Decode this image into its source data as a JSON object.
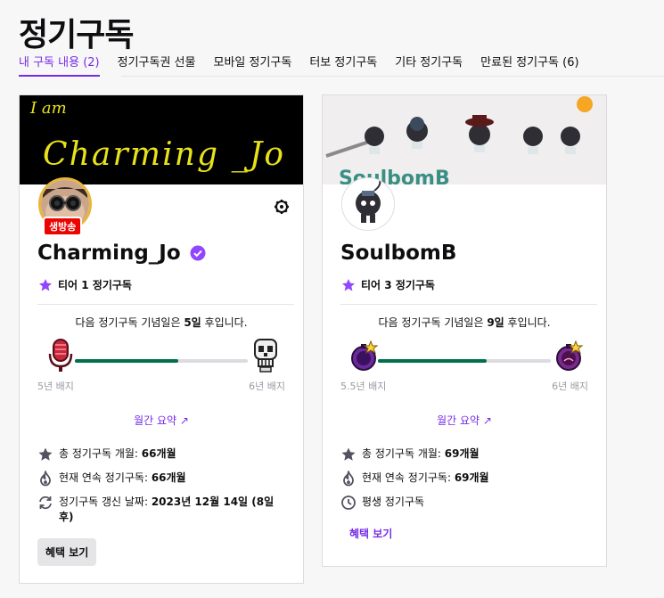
{
  "page": {
    "title": "정기구독"
  },
  "tabs": [
    {
      "label": "내 구독 내용 (2)",
      "active": true
    },
    {
      "label": "정기구독권 선물",
      "active": false
    },
    {
      "label": "모바일 정기구독",
      "active": false
    },
    {
      "label": "터보 정기구독",
      "active": false
    },
    {
      "label": "기타 정기구독",
      "active": false
    },
    {
      "label": "만료된 정기구독 (6)",
      "active": false
    }
  ],
  "subscriptions": [
    {
      "banner_text": [
        "I am",
        "Charming _Jo"
      ],
      "live_label": "생방송",
      "name": "Charming_Jo",
      "verified": true,
      "tier": "티어 1 정기구독",
      "anniversary": {
        "prefix": "다음 정기구독 기념일은 ",
        "days": "5일",
        "suffix": " 후입니다."
      },
      "progress": 0.6,
      "badge_current": "5년 배지",
      "badge_next": "6년 배지",
      "monthly_recap": "월간 요약 ↗",
      "stats": [
        {
          "icon": "star-icon",
          "label": "총 정기구독 개월: ",
          "value": "66개월"
        },
        {
          "icon": "flame-icon",
          "label": "현재 연속 정기구독: ",
          "value": "66개월"
        },
        {
          "icon": "renew-icon",
          "label": "정기구독 갱신 날짜: ",
          "value": "2023년 12월 14일 (8일 후)"
        }
      ],
      "benefits": "혜택 보기"
    },
    {
      "banner_text": [
        "SoulbomB"
      ],
      "name": "SoulbomB",
      "verified": false,
      "tier": "티어 3 정기구독",
      "anniversary": {
        "prefix": "다음 정기구독 기념일은 ",
        "days": "9일",
        "suffix": " 후입니다."
      },
      "progress": 0.63,
      "badge_current": "5.5년 배지",
      "badge_next": "6년 배지",
      "monthly_recap": "월간 요약 ↗",
      "stats": [
        {
          "icon": "star-icon",
          "label": "총 정기구독 개월: ",
          "value": "69개월"
        },
        {
          "icon": "flame-icon",
          "label": "현재 연속 정기구독: ",
          "value": "69개월"
        },
        {
          "icon": "clock-icon",
          "label": "평생 정기구독",
          "value": ""
        }
      ],
      "benefits": "혜택 보기"
    }
  ],
  "colors": {
    "accent": "#772ce8",
    "progress": "#00704a",
    "live": "#eb0400"
  }
}
